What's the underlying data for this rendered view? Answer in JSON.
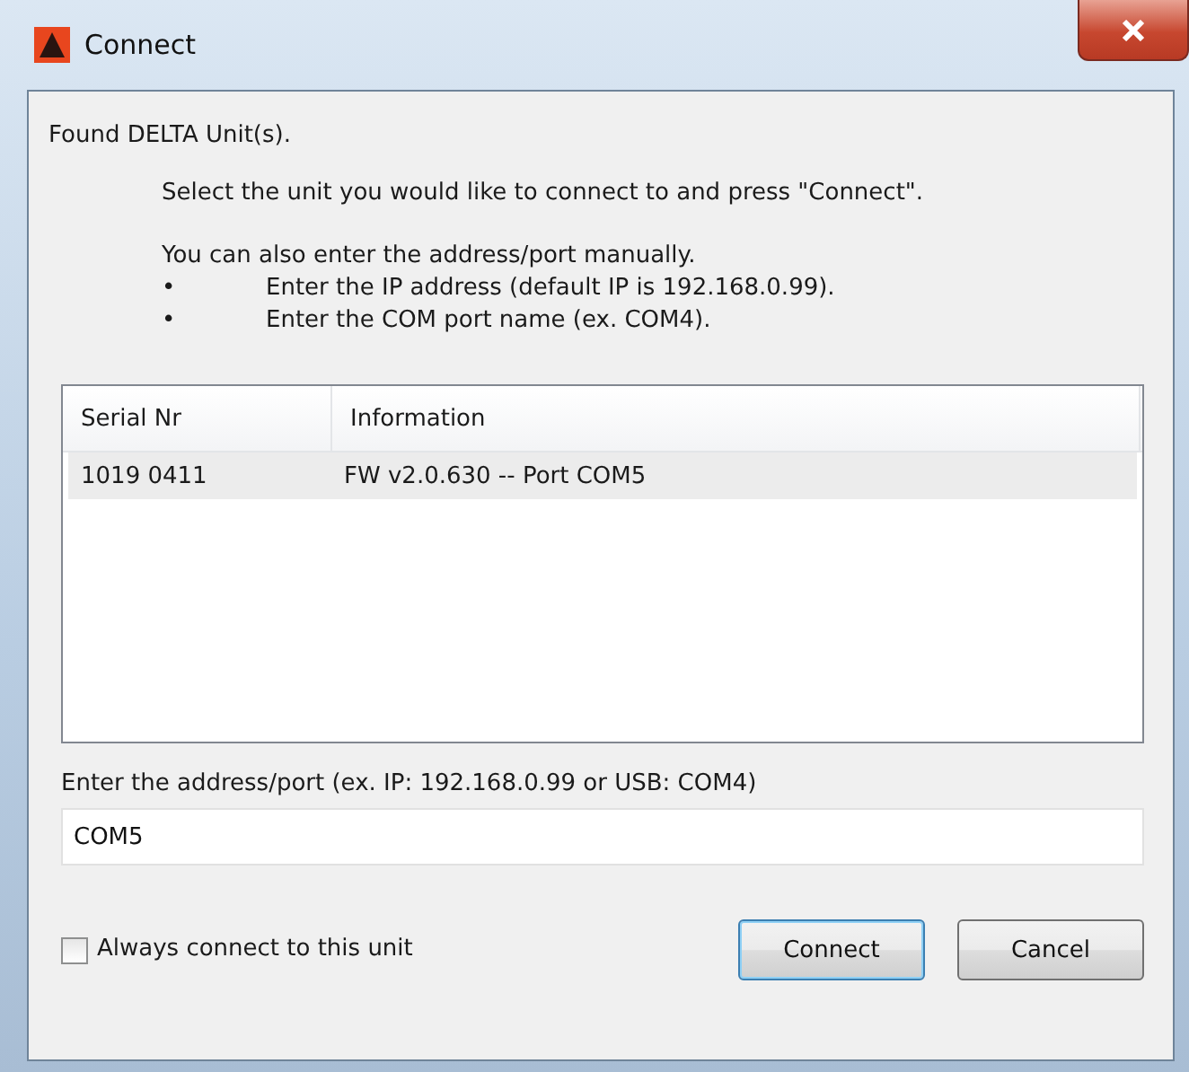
{
  "window": {
    "title": "Connect"
  },
  "heading": "Found DELTA Unit(s).",
  "instruction": "Select the unit you would like to connect to and press \"Connect\".",
  "manual_note": "You can also enter the address/port manually.",
  "bullets": [
    {
      "mark": "•",
      "text": "Enter the IP address (default IP is 192.168.0.99)."
    },
    {
      "mark": "•",
      "text": "Enter the COM port name (ex. COM4)."
    }
  ],
  "table": {
    "columns": [
      "Serial Nr",
      "Information"
    ],
    "rows": [
      {
        "cells": [
          "1019 0411",
          "FW v2.0.630 -- Port COM5"
        ],
        "selected": true
      }
    ]
  },
  "address": {
    "label": "Enter the address/port (ex. IP: 192.168.0.99 or USB: COM4)",
    "value": "COM5"
  },
  "always_connect": {
    "label": "Always connect to this unit",
    "checked": false
  },
  "buttons": [
    {
      "label": "Connect",
      "default": true
    },
    {
      "label": "Cancel",
      "default": false
    }
  ]
}
